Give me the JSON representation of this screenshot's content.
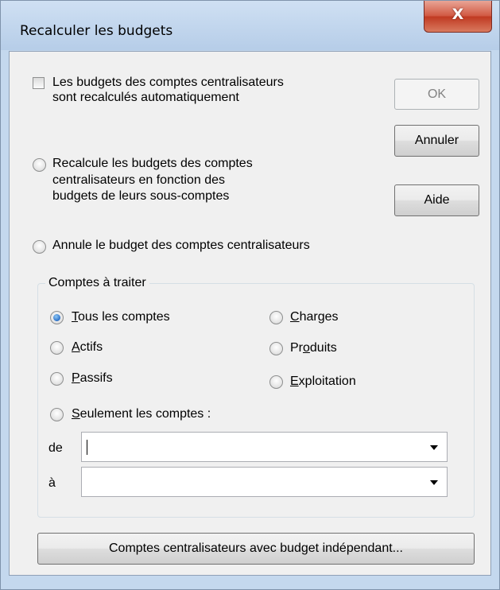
{
  "window": {
    "title": "Recalculer les budgets",
    "close_label": "X"
  },
  "options": {
    "auto_recalc": {
      "label_line1": "Les budgets des comptes centralisateurs",
      "label_line2": "sont recalculés automatiquement",
      "checked": false
    },
    "recalc_from_sub": {
      "label_line1": "Recalcule les budgets des comptes",
      "label_line2": "centralisateurs en fonction des",
      "label_line3": "budgets de leurs sous-comptes",
      "selected": false
    },
    "cancel_budget": {
      "label": "Annule le budget des comptes centralisateurs",
      "selected": false
    }
  },
  "buttons": {
    "ok": "OK",
    "cancel": "Annuler",
    "help": "Aide",
    "independent": "Comptes centralisateurs avec budget indépendant..."
  },
  "accounts_group": {
    "title": "Comptes à traiter",
    "radios": [
      {
        "mnemonic": "T",
        "rest": "ous les comptes",
        "selected": true
      },
      {
        "mnemonic": "A",
        "rest": "ctifs",
        "selected": false
      },
      {
        "mnemonic": "P",
        "rest": "assifs",
        "selected": false
      },
      {
        "mnemonic": "S",
        "rest": "eulement les comptes :",
        "selected": false
      },
      {
        "mnemonic": "C",
        "rest": "harges",
        "selected": false
      },
      {
        "pre": "Pr",
        "mnemonic": "o",
        "rest": "duits",
        "selected": false
      },
      {
        "mnemonic": "E",
        "rest": "xploitation",
        "selected": false
      }
    ],
    "from_label": "de",
    "to_label": "à",
    "from_value": "",
    "to_value": ""
  },
  "colors": {
    "accent": "#2a6fc7",
    "close_button": "#c03a22",
    "window_frame": "#c4d8ee",
    "client_bg": "#f0f0f0"
  }
}
